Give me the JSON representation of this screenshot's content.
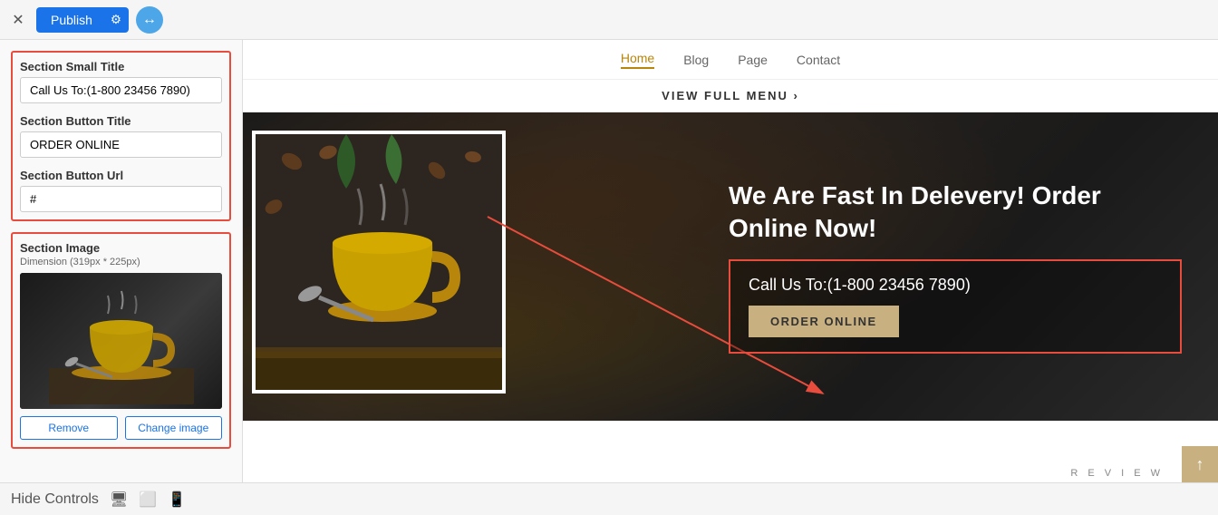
{
  "topbar": {
    "close_icon": "✕",
    "publish_label": "Publish",
    "gear_icon": "⚙",
    "nav_icon": "↔"
  },
  "left_panel": {
    "fields_red_border": true,
    "small_title": {
      "label": "Section Small Title",
      "value": "Call Us To:(1-800 23456 7890)"
    },
    "button_title": {
      "label": "Section Button Title",
      "value": "ORDER ONLINE"
    },
    "button_url": {
      "label": "Section Button Url",
      "value": "#"
    },
    "section_image": {
      "label": "Section Image",
      "dimension": "Dimension (319px * 225px)",
      "remove_label": "Remove",
      "change_label": "Change image"
    }
  },
  "preview": {
    "nav": {
      "items": [
        {
          "label": "Home",
          "active": true
        },
        {
          "label": "Blog",
          "active": false
        },
        {
          "label": "Page",
          "active": false
        },
        {
          "label": "Contact",
          "active": false
        }
      ]
    },
    "view_menu": "VIEW FULL MENU ›",
    "hero": {
      "title": "We Are Fast In Delevery! Order Online Now!",
      "phone": "Call Us To:(1-800 23456 7890)",
      "cta_button": "ORDER ONLINE"
    }
  },
  "bottom_bar": {
    "hide_controls": "Hide Controls",
    "desktop_icon": "🖥",
    "tablet_icon": "⬜",
    "phone_icon": "📱"
  },
  "scroll_btn": "↑",
  "review_text": "R E V I E W"
}
